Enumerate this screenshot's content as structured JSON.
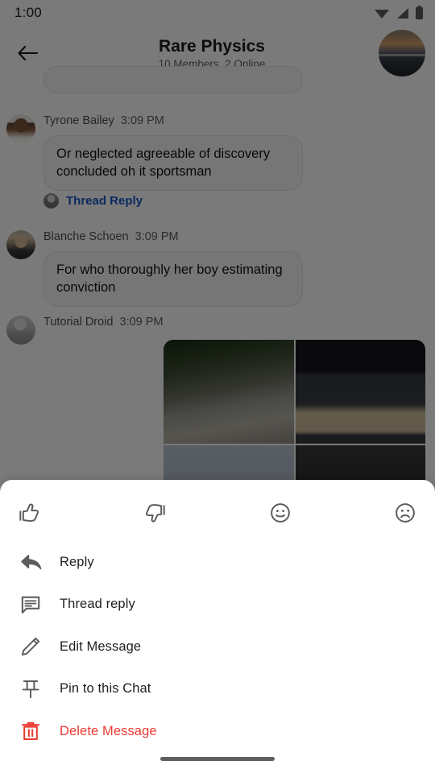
{
  "status_bar": {
    "clock": "1:00",
    "icons": [
      "wifi-icon",
      "cellular-signal-icon",
      "battery-icon"
    ]
  },
  "app_bar": {
    "back_icon": "arrow-back-icon",
    "title": "Rare Physics",
    "subtitle": "10 Members, 2 Online",
    "avatar": "group-avatar"
  },
  "messages": [
    {
      "author": "Tyrone Bailey",
      "time": "3:09 PM",
      "text": "Or neglected agreeable of discovery concluded oh it sportsman",
      "thread_reply_label": "Thread Reply"
    },
    {
      "author": "Blanche Schoen",
      "time": "3:09 PM",
      "text": "For who thoroughly her boy estimating conviction"
    },
    {
      "author": "Tutorial Droid",
      "time": "3:09 PM",
      "attachments": [
        "waterfall-photo",
        "desk-setup-photo",
        "sky-photo",
        "dark-photo"
      ]
    }
  ],
  "action_sheet": {
    "reactions": [
      {
        "name": "thumbs-up-icon",
        "label": "Thumbs up"
      },
      {
        "name": "thumbs-down-icon",
        "label": "Thumbs down"
      },
      {
        "name": "smiley-face-icon",
        "label": "Smile"
      },
      {
        "name": "sad-face-icon",
        "label": "Sad"
      }
    ],
    "menu_items": [
      {
        "icon": "reply-arrow-icon",
        "label": "Reply",
        "danger": false
      },
      {
        "icon": "chat-bubble-icon",
        "label": "Thread reply",
        "danger": false
      },
      {
        "icon": "pencil-icon",
        "label": "Edit Message",
        "danger": false
      },
      {
        "icon": "pin-icon",
        "label": "Pin to this Chat",
        "danger": false
      },
      {
        "icon": "trash-icon",
        "label": "Delete Message",
        "danger": true
      }
    ]
  },
  "colors": {
    "danger": "#ea3b33",
    "link": "#1a56c4",
    "icon_grey": "#5c5c5c",
    "scrim": "rgba(0,0,0,0.52)",
    "sheet_background": "#ffffff"
  },
  "home_indicator": "home-indicator-bar"
}
